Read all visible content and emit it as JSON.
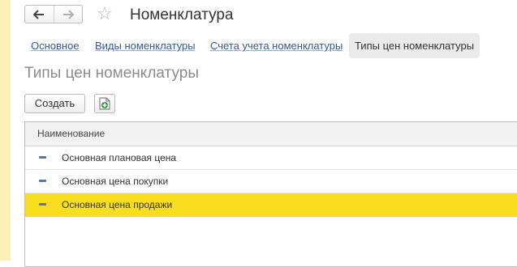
{
  "window": {
    "title": "Номенклатура"
  },
  "tabs": [
    {
      "label": "Основное"
    },
    {
      "label": "Виды номенклатуры"
    },
    {
      "label": "Счета учета номенклатуры"
    },
    {
      "label": "Типы цен номенклатуры"
    }
  ],
  "page": {
    "title": "Типы цен номенклатуры"
  },
  "toolbar": {
    "create_label": "Создать"
  },
  "table": {
    "column_header": "Наименование",
    "rows": [
      {
        "name": "Основная плановая цена"
      },
      {
        "name": "Основная цена покупки"
      },
      {
        "name": "Основная цена продажи"
      }
    ],
    "selected_row": 2
  },
  "colors": {
    "selection": "#f9dd1f",
    "link": "#2d5c9c",
    "left_stripe": "#fbf0b6"
  },
  "icons": [
    "arrow-left-icon",
    "arrow-right-icon",
    "star-icon",
    "add-copy-icon",
    "row-dash-icon"
  ]
}
